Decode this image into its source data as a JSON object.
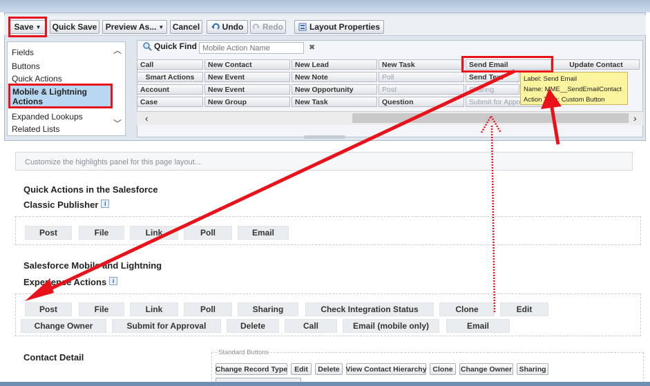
{
  "toolbar": {
    "save": "Save",
    "quick_save": "Quick Save",
    "preview_as": "Preview As...",
    "cancel": "Cancel",
    "undo": "Undo",
    "redo": "Redo",
    "layout_properties": "Layout Properties"
  },
  "categories": [
    "Fields",
    "Buttons",
    "Quick Actions",
    "Mobile & Lightning Actions",
    "Expanded Lookups",
    "Related Lists"
  ],
  "selected_category": "Mobile & Lightning Actions",
  "quick_find": {
    "label": "Quick Find",
    "placeholder": "Mobile Action Name",
    "clear": "✖"
  },
  "palette": {
    "rows": [
      [
        "Call",
        "New Contact",
        "New Lead",
        "New Task",
        "Send Email",
        "Update Contact"
      ],
      [
        "Smart Actions",
        "New Event",
        "New Note",
        "Poll",
        "Send Text"
      ],
      [
        "Account",
        "New Event",
        "New Opportunity",
        "Post",
        "Sharing"
      ],
      [
        "Case",
        "New Group",
        "New Task",
        "Question",
        "Submit for Approval"
      ]
    ],
    "dimmed": [
      "Poll",
      "Post",
      "Sharing",
      "Submit for Approval"
    ]
  },
  "tooltip": {
    "label": "Label: Send Email",
    "name": "Name: MME__SendEmailContact",
    "action_type": "Action Type: Custom Button"
  },
  "highlights_hint": "Customize the highlights panel for this page layout...",
  "classic": {
    "title_line1": "Quick Actions in the Salesforce",
    "title_line2": "Classic Publisher",
    "actions": [
      "Post",
      "File",
      "Link",
      "Poll",
      "Email"
    ]
  },
  "mobile": {
    "title_line1": "Salesforce Mobile and Lightning",
    "title_line2": "Experience Actions",
    "row1": [
      "Post",
      "File",
      "Link",
      "Poll",
      "Sharing",
      "Check Integration Status",
      "Clone",
      "Edit"
    ],
    "row2": [
      "Change Owner",
      "Submit for Approval",
      "Delete",
      "Call",
      "Email (mobile only)",
      "Email"
    ]
  },
  "contact_detail": {
    "title": "Contact Detail",
    "standard_buttons_label": "Standard Buttons",
    "buttons": [
      "Change Record Type",
      "Edit",
      "Delete",
      "View Contact Hierarchy",
      "Clone",
      "Change Owner",
      "Sharing"
    ]
  },
  "info_glyph": "i",
  "colors": {
    "annotation_red": "#e8121a",
    "selection_blue": "#b8d7f2",
    "tooltip_yellow": "#fdf4a0"
  }
}
